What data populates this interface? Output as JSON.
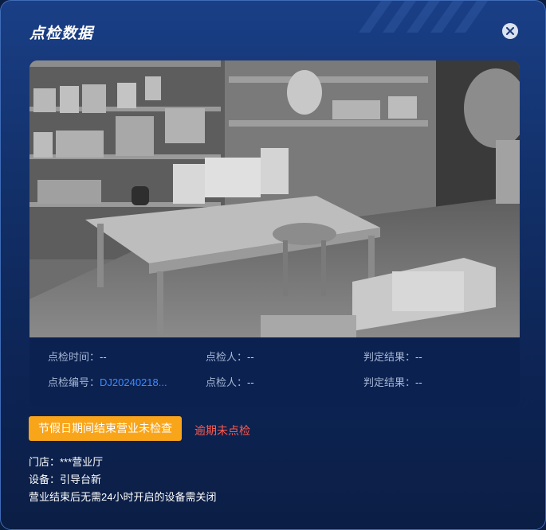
{
  "dialog": {
    "title": "点检数据",
    "close_icon": "close-icon"
  },
  "info": {
    "row1": [
      {
        "label": "点检时间：",
        "value": "--"
      },
      {
        "label": "点检人：",
        "value": "--"
      },
      {
        "label": "判定结果：",
        "value": "--"
      }
    ],
    "row2": [
      {
        "label": "点检编号：",
        "value": "DJ20240218..."
      },
      {
        "label": "点检人：",
        "value": "--"
      },
      {
        "label": "判定结果：",
        "value": "--"
      }
    ]
  },
  "status": {
    "tag": "节假日期间结束营业未检查",
    "overdue": "逾期未点检",
    "tag_color": "#f9a51a",
    "overdue_color": "#ff5a4e"
  },
  "details": {
    "store": "门店：***营业厅",
    "device": "设备：引导台新",
    "note": "营业结束后无需24小时开启的设备需关闭"
  }
}
